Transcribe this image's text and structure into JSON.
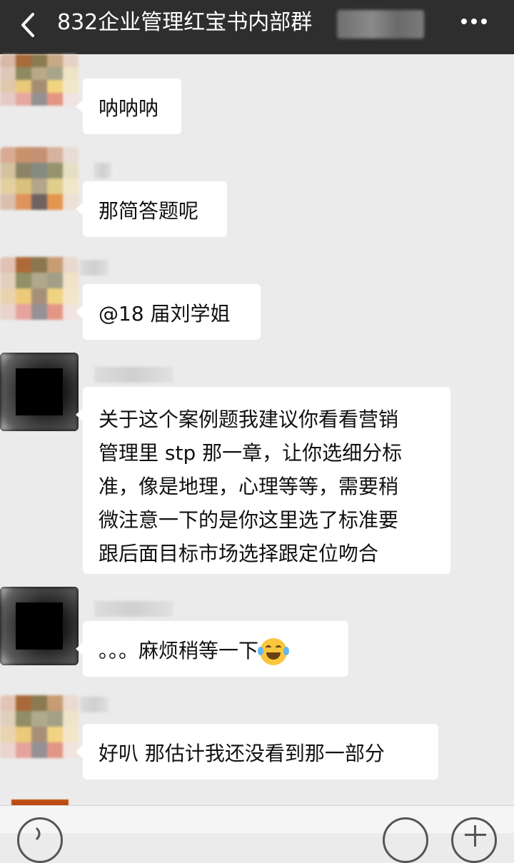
{
  "header": {
    "title": "832企业管理红宝书内部群",
    "back_icon": "chevron-left-icon",
    "more_icon": "more-horizontal-icon",
    "background": "#2e2e2e"
  },
  "messages": [
    {
      "text": "呐呐呐"
    },
    {
      "text": "那简答题呢"
    },
    {
      "text": "@18 届刘学姐"
    },
    {
      "lines": [
        "关于这个案例题我建议你看看营销",
        "管理里 stp 那一章，让你选细分标",
        "准，像是地理，心理等等，需要稍",
        "微注意一下的是你这里选了标准要",
        "跟后面目标市场选择跟定位吻合"
      ]
    },
    {
      "text": "。。。麻烦稍等一下",
      "emoji": "laughing-tears-emoji"
    },
    {
      "text": "好叭 那估计我还没看到那一部分"
    }
  ],
  "bottom_bar": {
    "voice_icon": "voice-icon",
    "emoji_icon": "emoji-icon",
    "plus_icon": "plus-icon"
  },
  "colors": {
    "chat_background": "#ebebeb",
    "bubble": "#ffffff",
    "text": "#111111"
  }
}
